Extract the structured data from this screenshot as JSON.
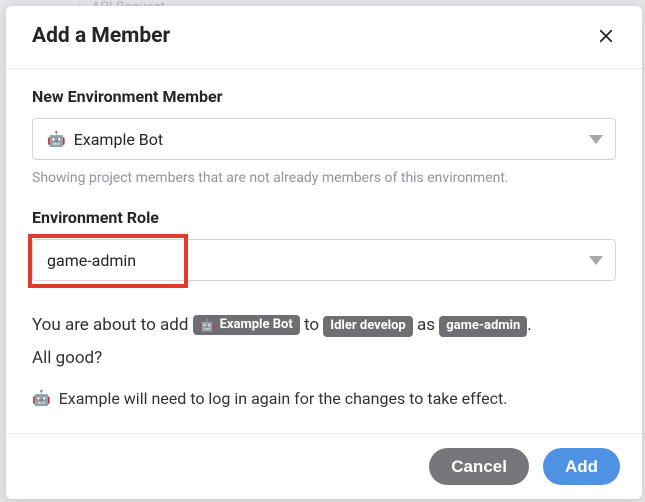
{
  "background": {
    "hint_text": "API Request"
  },
  "modal": {
    "title": "Add a Member",
    "member": {
      "label": "New Environment Member",
      "selected_icon": "🤖",
      "selected": "Example Bot",
      "helper": "Showing project members that are not already members of this environment."
    },
    "role": {
      "label": "Environment Role",
      "selected": "game-admin"
    },
    "confirm": {
      "prefix": "You are about to add",
      "member_chip_icon": "🤖",
      "member_chip_label": "Example Bot",
      "mid1": "to",
      "env_chip_label": "Idler develop",
      "mid2": "as",
      "role_chip_label": "game-admin",
      "suffix": ".",
      "question": "All good?"
    },
    "relogin": {
      "icon": "🤖",
      "text": "Example will need to log in again for the changes to take effect."
    },
    "buttons": {
      "cancel": "Cancel",
      "add": "Add"
    }
  }
}
